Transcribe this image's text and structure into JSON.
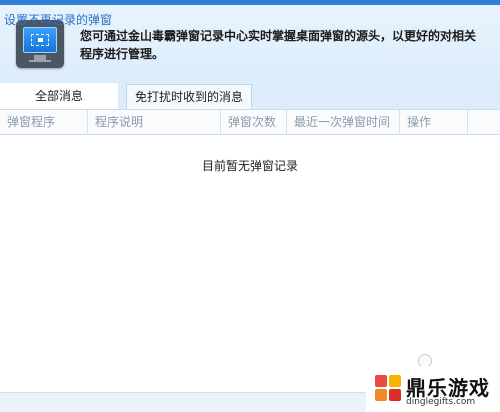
{
  "header": {
    "description": "您可通过金山毒霸弹窗记录中心实时掌握桌面弹窗的源头，以更好的对相关程序进行管理。",
    "icon": "monitor-popup-icon"
  },
  "tabs": [
    {
      "label": "全部消息",
      "active": true
    },
    {
      "label": "免打扰时收到的消息",
      "active": false
    }
  ],
  "table": {
    "columns": [
      "弹窗程序",
      "程序说明",
      "弹窗次数",
      "最近一次弹窗时间",
      "操作",
      ""
    ],
    "empty_message": "目前暂无弹窗记录"
  },
  "footer": {
    "settings_link": "设置不再记录的弹窗"
  },
  "watermark": {
    "name": "鼎乐游戏",
    "url": "dinglegifts.com"
  },
  "colors": {
    "accent": "#2f7fd6",
    "header_bg": "#dcecfb",
    "column_text": "#8a9bb0",
    "link": "#2b6fc2"
  }
}
